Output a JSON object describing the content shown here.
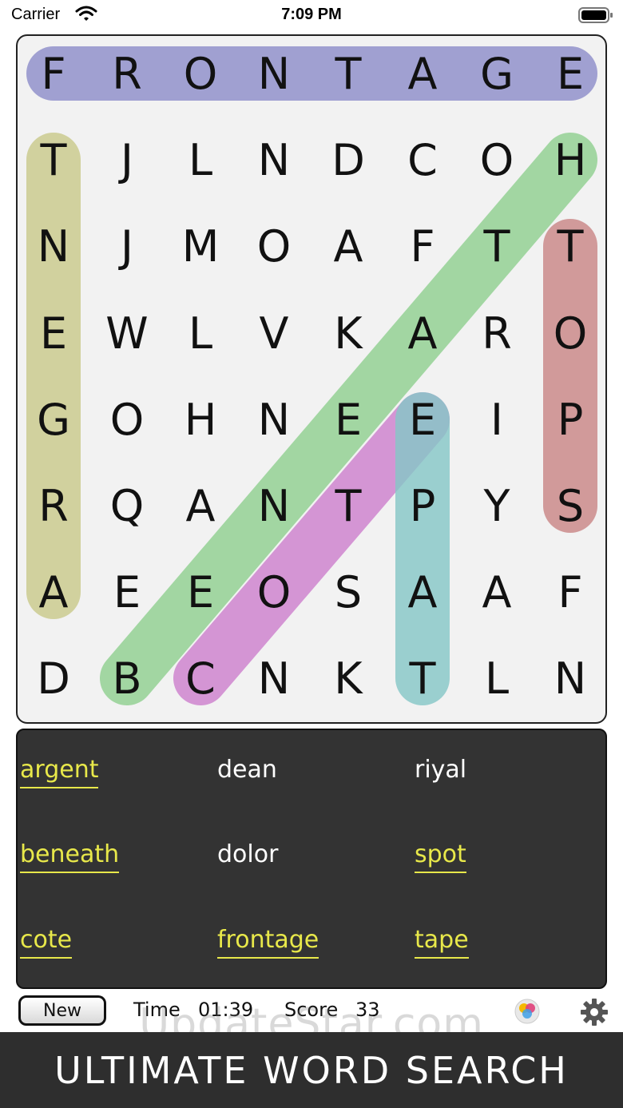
{
  "status_bar": {
    "carrier": "Carrier",
    "time": "7:09 PM"
  },
  "grid": {
    "rows": [
      [
        "F",
        "R",
        "O",
        "N",
        "T",
        "A",
        "G",
        "E"
      ],
      [
        "T",
        "J",
        "L",
        "N",
        "D",
        "C",
        "O",
        "H"
      ],
      [
        "N",
        "J",
        "M",
        "O",
        "A",
        "F",
        "T",
        "T"
      ],
      [
        "E",
        "W",
        "L",
        "V",
        "K",
        "A",
        "R",
        "O"
      ],
      [
        "G",
        "O",
        "H",
        "N",
        "E",
        "E",
        "I",
        "P"
      ],
      [
        "R",
        "Q",
        "A",
        "N",
        "T",
        "P",
        "Y",
        "S"
      ],
      [
        "A",
        "E",
        "E",
        "O",
        "S",
        "A",
        "A",
        "F"
      ],
      [
        "D",
        "B",
        "C",
        "N",
        "K",
        "T",
        "L",
        "N"
      ]
    ],
    "highlight_colors": [
      "#8c8cc9",
      "#c9c98a",
      "#8fd08f",
      "#c98585",
      "#cd7fcd",
      "#85c7c7"
    ]
  },
  "words": [
    {
      "text": "argent",
      "found": true
    },
    {
      "text": "dean",
      "found": false
    },
    {
      "text": "riyal",
      "found": false
    },
    {
      "text": "beneath",
      "found": true
    },
    {
      "text": "dolor",
      "found": false
    },
    {
      "text": "spot",
      "found": true
    },
    {
      "text": "cote",
      "found": true
    },
    {
      "text": "frontage",
      "found": true
    },
    {
      "text": "tape",
      "found": true
    }
  ],
  "footer": {
    "new_label": "New",
    "time_label": "Time",
    "time_value": "01:39",
    "score_label": "Score",
    "score_value": "33"
  },
  "watermark": "UpdateStar.com",
  "banner": "ULTIMATE WORD SEARCH"
}
